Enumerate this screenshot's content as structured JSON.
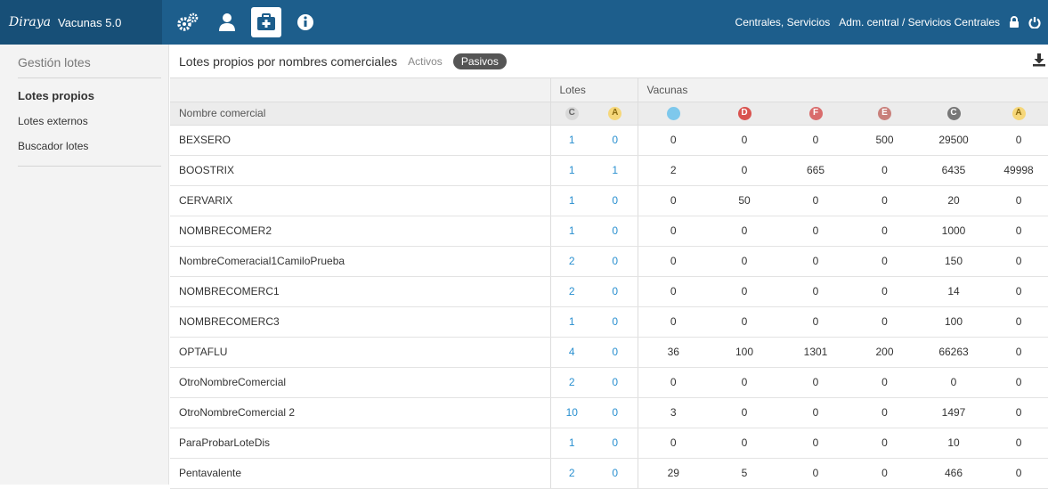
{
  "header": {
    "brand": "Diraya",
    "app": "Vacunas 5.0",
    "center": "Centrales, Servicios",
    "user": "Adm. central / Servicios Centrales",
    "color": "#1d5e8c"
  },
  "nav_icons": [
    "cogs-icon",
    "user-icon",
    "medical-kit-icon",
    "info-icon"
  ],
  "sidebar": {
    "title": "Gestión lotes",
    "items": [
      {
        "label": "Lotes propios",
        "active": true
      },
      {
        "label": "Lotes externos",
        "active": false
      },
      {
        "label": "Buscador lotes",
        "active": false
      }
    ]
  },
  "main": {
    "title": "Lotes propios por nombres comerciales",
    "tab_activos": "Activos",
    "tab_pasivos": "Pasivos"
  },
  "table": {
    "group_lotes": "Lotes",
    "group_vacunas": "Vacunas",
    "col_name": "Nombre comercial",
    "badges": {
      "lote_c": {
        "letter": "C",
        "bg": "#d9d9d9",
        "fg": "#666666"
      },
      "lote_a": {
        "letter": "A",
        "bg": "#f6d77a",
        "fg": "#8a6a10"
      },
      "vac_blank": {
        "letter": "",
        "bg": "#7ec8ec",
        "fg": "#ffffff"
      },
      "vac_d": {
        "letter": "D",
        "bg": "#d9534f",
        "fg": "#ffffff"
      },
      "vac_f": {
        "letter": "F",
        "bg": "#d96c6c",
        "fg": "#ffffff"
      },
      "vac_e": {
        "letter": "E",
        "bg": "#c9807b",
        "fg": "#ffffff"
      },
      "vac_c": {
        "letter": "C",
        "bg": "#777777",
        "fg": "#ffffff"
      },
      "vac_a": {
        "letter": "A",
        "bg": "#f6d77a",
        "fg": "#8a6a10"
      }
    },
    "rows": [
      {
        "name": "BEXSERO",
        "lc": "1",
        "la": "0",
        "v1": "0",
        "vd": "0",
        "vf": "0",
        "ve": "500",
        "vc": "29500",
        "va": "0"
      },
      {
        "name": "BOOSTRIX",
        "lc": "1",
        "la": "1",
        "v1": "2",
        "vd": "0",
        "vf": "665",
        "ve": "0",
        "vc": "6435",
        "va": "49998"
      },
      {
        "name": "CERVARIX",
        "lc": "1",
        "la": "0",
        "v1": "0",
        "vd": "50",
        "vf": "0",
        "ve": "0",
        "vc": "20",
        "va": "0"
      },
      {
        "name": "NOMBRECOMER2",
        "lc": "1",
        "la": "0",
        "v1": "0",
        "vd": "0",
        "vf": "0",
        "ve": "0",
        "vc": "1000",
        "va": "0"
      },
      {
        "name": "NombreComeracial1CamiloPrueba",
        "lc": "2",
        "la": "0",
        "v1": "0",
        "vd": "0",
        "vf": "0",
        "ve": "0",
        "vc": "150",
        "va": "0"
      },
      {
        "name": "NOMBRECOMERC1",
        "lc": "2",
        "la": "0",
        "v1": "0",
        "vd": "0",
        "vf": "0",
        "ve": "0",
        "vc": "14",
        "va": "0"
      },
      {
        "name": "NOMBRECOMERC3",
        "lc": "1",
        "la": "0",
        "v1": "0",
        "vd": "0",
        "vf": "0",
        "ve": "0",
        "vc": "100",
        "va": "0"
      },
      {
        "name": "OPTAFLU",
        "lc": "4",
        "la": "0",
        "v1": "36",
        "vd": "100",
        "vf": "1301",
        "ve": "200",
        "vc": "66263",
        "va": "0"
      },
      {
        "name": "OtroNombreComercial",
        "lc": "2",
        "la": "0",
        "v1": "0",
        "vd": "0",
        "vf": "0",
        "ve": "0",
        "vc": "0",
        "va": "0"
      },
      {
        "name": "OtroNombreComercial 2",
        "lc": "10",
        "la": "0",
        "v1": "3",
        "vd": "0",
        "vf": "0",
        "ve": "0",
        "vc": "1497",
        "va": "0"
      },
      {
        "name": "ParaProbarLoteDis",
        "lc": "1",
        "la": "0",
        "v1": "0",
        "vd": "0",
        "vf": "0",
        "ve": "0",
        "vc": "10",
        "va": "0"
      },
      {
        "name": "Pentavalente",
        "lc": "2",
        "la": "0",
        "v1": "29",
        "vd": "5",
        "vf": "0",
        "ve": "0",
        "vc": "466",
        "va": "0"
      }
    ]
  }
}
